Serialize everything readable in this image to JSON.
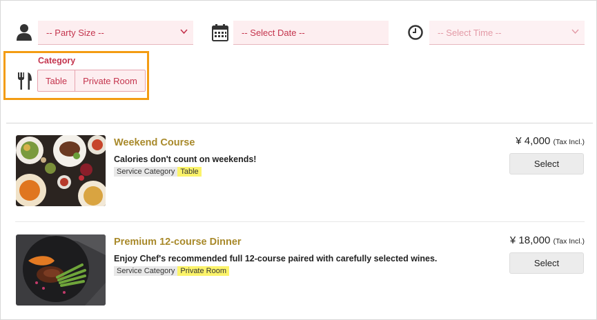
{
  "filters": {
    "party_size": {
      "placeholder": "-- Party Size --",
      "icon": "person-icon"
    },
    "date": {
      "placeholder": "-- Select Date --",
      "icon": "calendar-icon"
    },
    "time": {
      "placeholder": "-- Select Time --",
      "icon": "clock-icon",
      "disabled": true
    }
  },
  "category": {
    "label": "Category",
    "icon": "utensils-icon",
    "options": [
      "Table",
      "Private Room"
    ]
  },
  "courses": [
    {
      "name": "Weekend Course",
      "description": "Calories don't count on weekends!",
      "tag_key": "Service Category",
      "tag_value": "Table",
      "price": "¥ 4,000",
      "tax": "(Tax Incl.)",
      "select_label": "Select"
    },
    {
      "name": "Premium 12-course Dinner",
      "description": "Enjoy Chef's recommended full 12-course paired with carefully selected wines.",
      "tag_key": "Service Category",
      "tag_value": "Private Room",
      "price": "¥ 18,000",
      "tax": "(Tax Incl.)",
      "select_label": "Select"
    }
  ],
  "colors": {
    "accent": "#c4344d",
    "course_title": "#a8892a",
    "highlight_box": "#f39c12",
    "tag_highlight": "#fbf36a"
  }
}
